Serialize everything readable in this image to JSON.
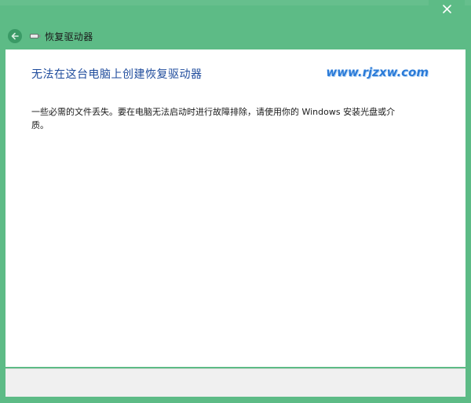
{
  "window": {
    "accent_color": "#5dbb86",
    "close_icon": "close-icon"
  },
  "nav": {
    "back_icon": "back-arrow-icon",
    "drive_icon": "usb-drive-icon",
    "title": "恢复驱动器"
  },
  "content": {
    "heading": "无法在这台电脑上创建恢复驱动器",
    "watermark": "www.rjzxw.com",
    "message": "一些必需的文件丢失。要在电脑无法启动时进行故障排除，请使用你的 Windows 安装光盘或介质。",
    "heading_color": "#1e4b9c"
  }
}
